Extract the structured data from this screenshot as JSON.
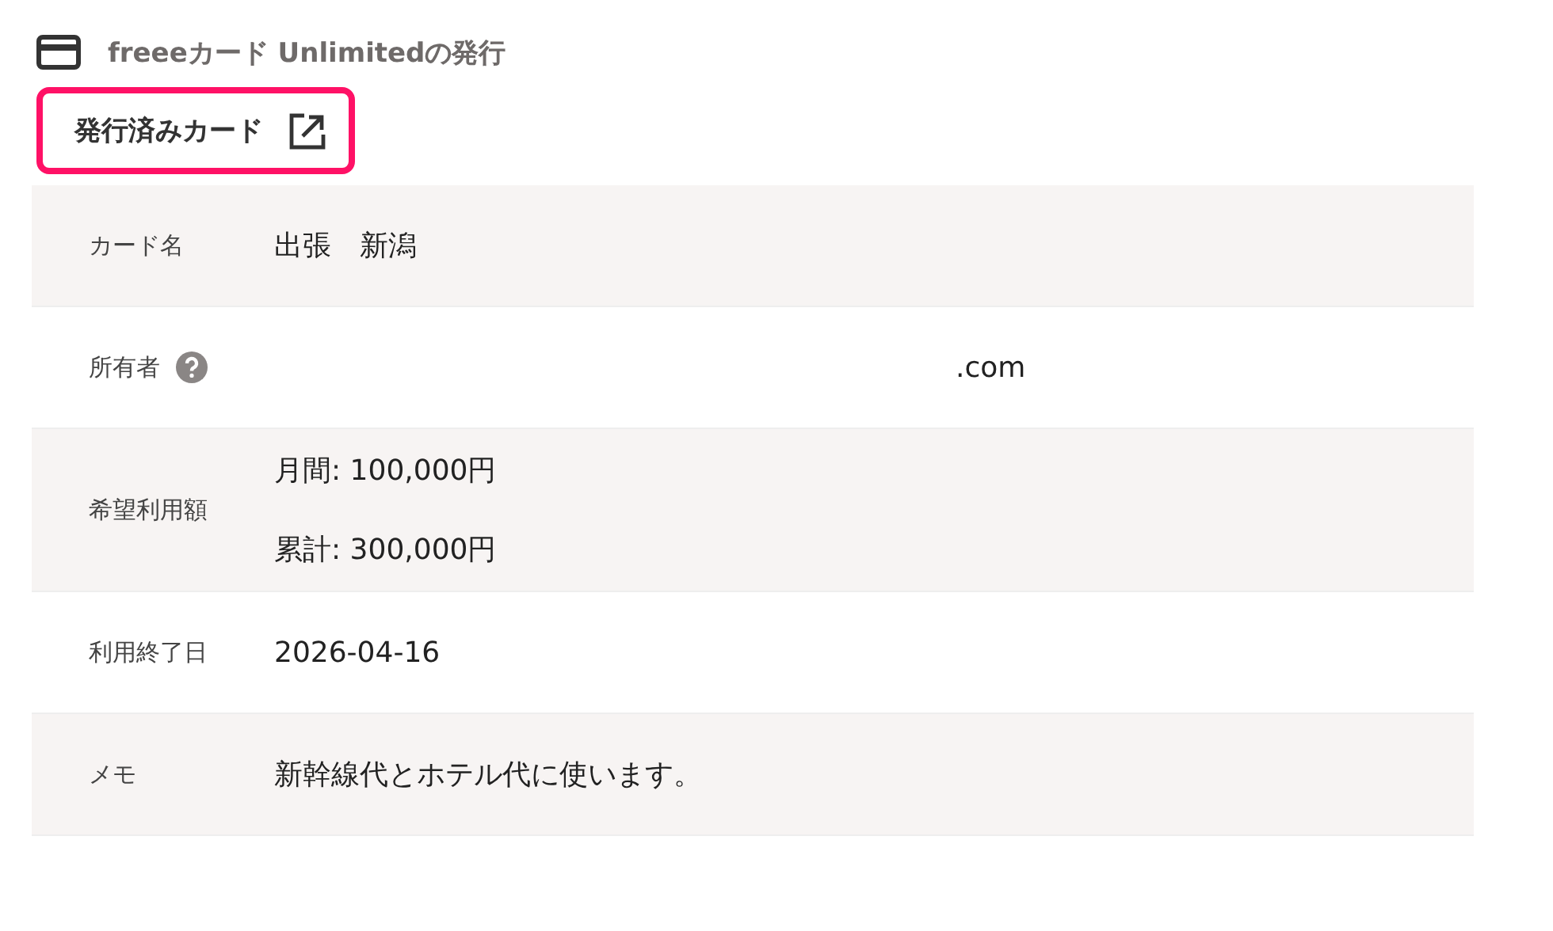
{
  "section": {
    "title": "freeeカード Unlimitedの発行"
  },
  "issued_cards_link": {
    "label": "発行済みカード",
    "highlighted": true
  },
  "rows": [
    {
      "label": "カード名",
      "values": [
        "出張　新潟"
      ]
    },
    {
      "label": "所有者",
      "help": true,
      "masked": true,
      "values": [
        ".com"
      ]
    },
    {
      "label": "希望利用額",
      "values": [
        "月間: 100,000円",
        "累計: 300,000円"
      ]
    },
    {
      "label": "利用終了日",
      "values": [
        "2026-04-16"
      ]
    },
    {
      "label": "メモ",
      "values": [
        "新幹線代とホテル代に使います。"
      ]
    }
  ]
}
